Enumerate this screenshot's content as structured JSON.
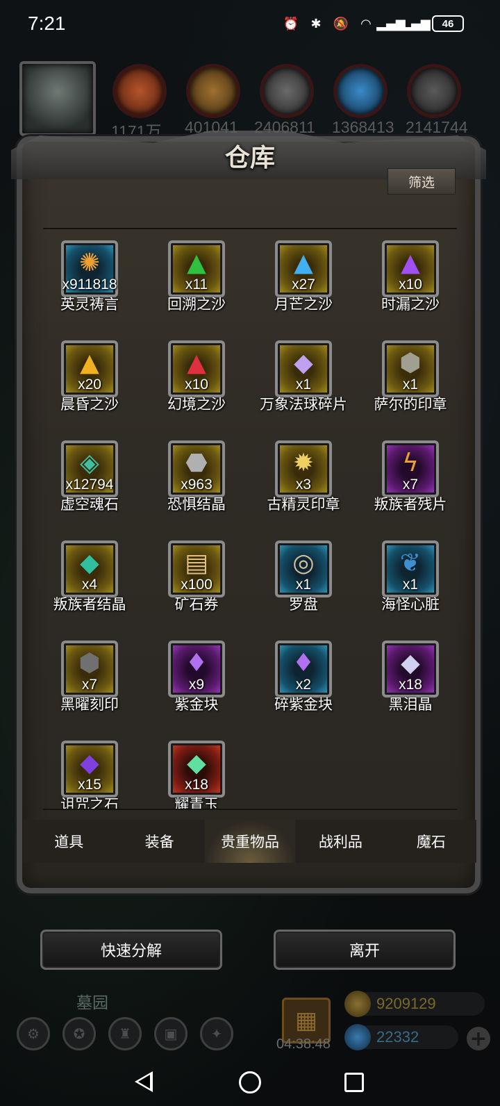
{
  "status_bar": {
    "time": "7:21",
    "battery": "46"
  },
  "resources": [
    "1171万",
    "401041",
    "2406811",
    "1368413",
    "2141744"
  ],
  "panel": {
    "title": "仓库",
    "filter_label": "筛选"
  },
  "items": [
    {
      "name": "英灵祷言",
      "qty": "x911818",
      "frame": "blue",
      "glyph": "✺",
      "color": "#f0a030"
    },
    {
      "name": "回溯之沙",
      "qty": "x11",
      "frame": "gold",
      "glyph": "▲",
      "color": "#30c040"
    },
    {
      "name": "月芒之沙",
      "qty": "x27",
      "frame": "gold",
      "glyph": "▲",
      "color": "#40b0f0"
    },
    {
      "name": "时漏之沙",
      "qty": "x10",
      "frame": "gold",
      "glyph": "▲",
      "color": "#a050f0"
    },
    {
      "name": "晨昏之沙",
      "qty": "x20",
      "frame": "gold",
      "glyph": "▲",
      "color": "#f0b020"
    },
    {
      "name": "幻境之沙",
      "qty": "x10",
      "frame": "gold",
      "glyph": "▲",
      "color": "#e03040"
    },
    {
      "name": "万象法球碎片",
      "qty": "x1",
      "frame": "gold",
      "glyph": "◆",
      "color": "#c0a0f0"
    },
    {
      "name": "萨尔的印章",
      "qty": "x1",
      "frame": "gold",
      "glyph": "⬢",
      "color": "#a0a090"
    },
    {
      "name": "虚空魂石",
      "qty": "x12794",
      "frame": "gold",
      "glyph": "◈",
      "color": "#40c0a0"
    },
    {
      "name": "恐惧结晶",
      "qty": "x963",
      "frame": "gold",
      "glyph": "⬣",
      "color": "#b0b0b0"
    },
    {
      "name": "古精灵印章",
      "qty": "x3",
      "frame": "gold",
      "glyph": "✹",
      "color": "#f0d060"
    },
    {
      "name": "叛族者残片",
      "qty": "x7",
      "frame": "purple",
      "glyph": "ϟ",
      "color": "#f0a030"
    },
    {
      "name": "叛族者结晶",
      "qty": "x4",
      "frame": "gold",
      "glyph": "◆",
      "color": "#30c0a0"
    },
    {
      "name": "矿石券",
      "qty": "x100",
      "frame": "gold",
      "glyph": "▤",
      "color": "#e0c080"
    },
    {
      "name": "罗盘",
      "qty": "x1",
      "frame": "blue",
      "glyph": "◎",
      "color": "#d0c0a0"
    },
    {
      "name": "海怪心脏",
      "qty": "x1",
      "frame": "blue",
      "glyph": "❦",
      "color": "#4090d0"
    },
    {
      "name": "黑曜刻印",
      "qty": "x7",
      "frame": "gold",
      "glyph": "⬢",
      "color": "#707070"
    },
    {
      "name": "紫金块",
      "qty": "x9",
      "frame": "purple",
      "glyph": "♦",
      "color": "#b070f0"
    },
    {
      "name": "碎紫金块",
      "qty": "x2",
      "frame": "blue",
      "glyph": "♦",
      "color": "#b070f0"
    },
    {
      "name": "黑泪晶",
      "qty": "x18",
      "frame": "purple",
      "glyph": "◆",
      "color": "#d0d0f0"
    },
    {
      "name": "诅咒之石",
      "qty": "x15",
      "frame": "gold",
      "glyph": "◆",
      "color": "#8040e0"
    },
    {
      "name": "耀青玉",
      "qty": "x18",
      "frame": "red",
      "glyph": "◆",
      "color": "#60e0a0"
    }
  ],
  "tabs": [
    "道具",
    "装备",
    "贵重物品",
    "战利品",
    "魔石"
  ],
  "active_tab": 2,
  "buttons": {
    "decompose": "快速分解",
    "leave": "离开"
  },
  "hud": {
    "area": "墓园",
    "timer": "04:38:48",
    "gold": "9209129",
    "gold_color": "#7a6a2a",
    "gems": "22332",
    "gems_color": "#3a6a8a"
  }
}
